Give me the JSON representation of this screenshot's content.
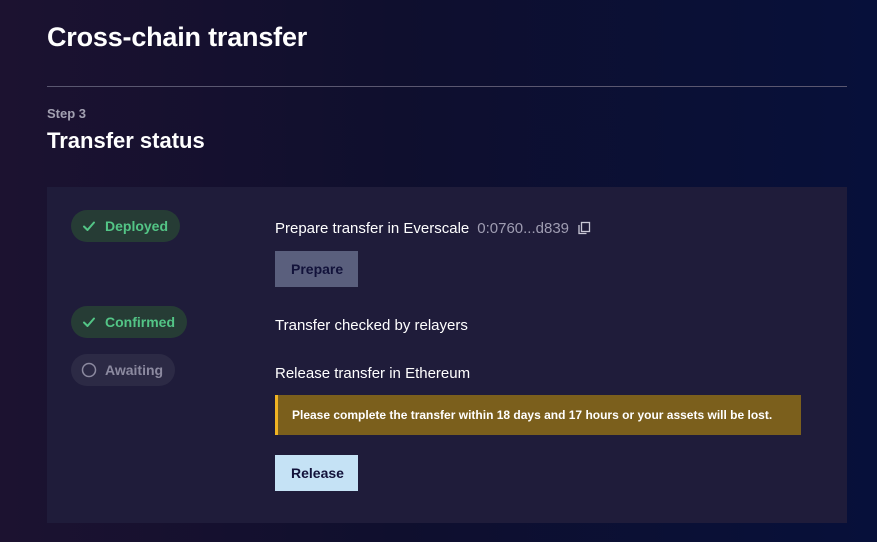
{
  "header": {
    "title": "Cross-chain transfer"
  },
  "step": {
    "label": "Step 3",
    "title": "Transfer status"
  },
  "steps": [
    {
      "status": "Deployed",
      "status_type": "success",
      "text": "Prepare transfer in Everscale",
      "address": "0:0760...d839",
      "button_label": "Prepare"
    },
    {
      "status": "Confirmed",
      "status_type": "success",
      "text": "Transfer checked by relayers"
    },
    {
      "status": "Awaiting",
      "status_type": "pending",
      "text": "Release transfer in Ethereum",
      "warning": "Please complete the transfer within 18 days and 17 hours or your assets will be lost.",
      "button_label": "Release"
    }
  ],
  "icons": {
    "deployed": "check-icon",
    "confirmed": "check-icon",
    "awaiting": "circle-icon",
    "copy": "copy-icon"
  },
  "colors": {
    "success": "#53c586",
    "pending": "#8c8aa0",
    "warning_bg": "#7b5f1c",
    "warning_border": "#f0b323",
    "release_button": "#c5e2f5",
    "prepare_button": "#5a5f7d"
  }
}
